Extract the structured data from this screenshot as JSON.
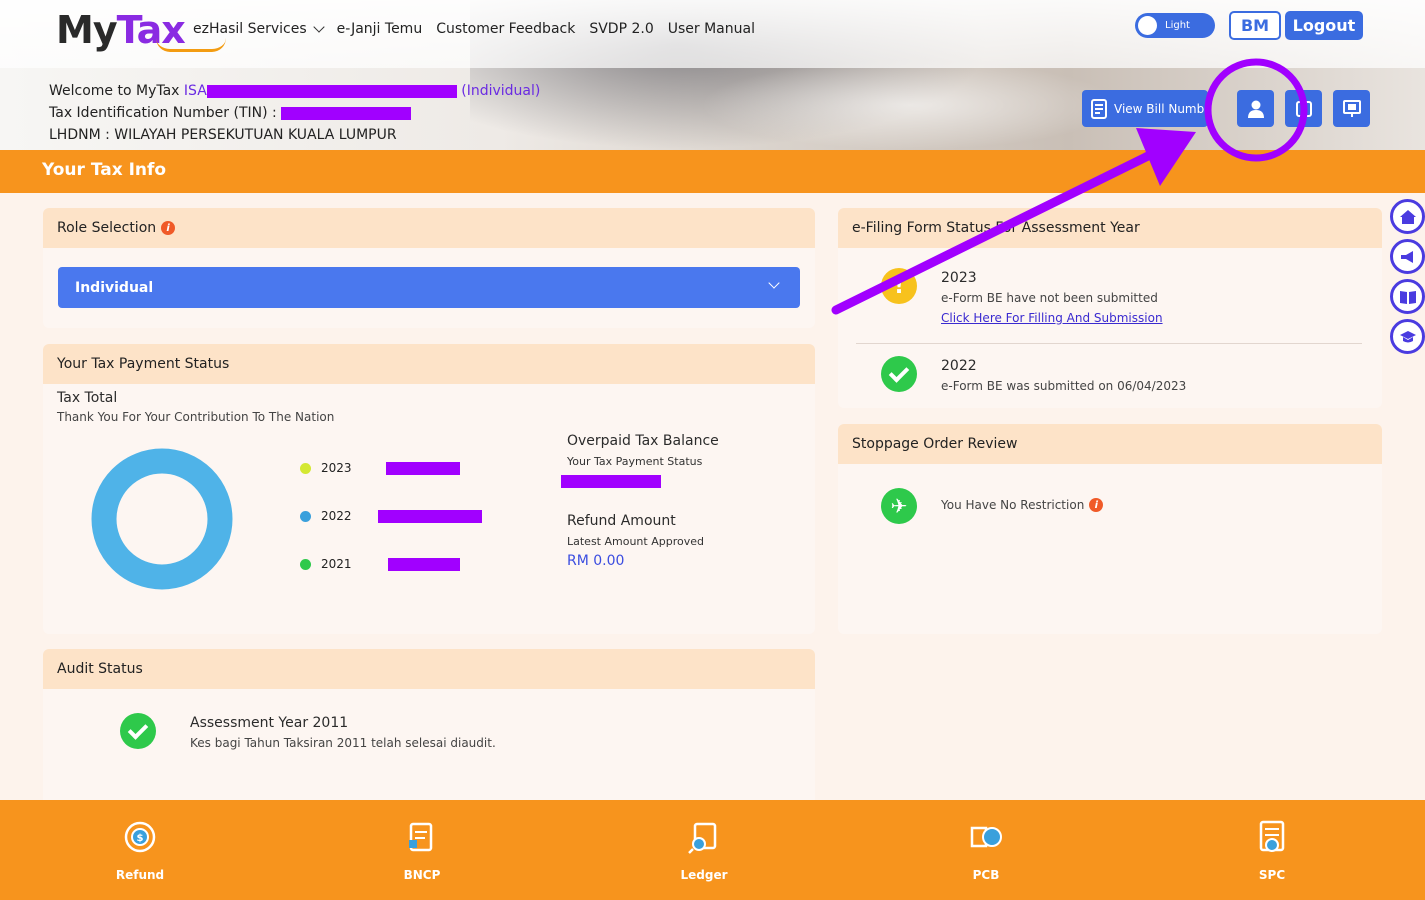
{
  "header": {
    "logo_my": "My",
    "logo_tax": "Tax",
    "nav": [
      {
        "label": "ezHasil Services",
        "dropdown": true
      },
      {
        "label": "e-Janji Temu"
      },
      {
        "label": "Customer Feedback"
      },
      {
        "label": "SVDP 2.0"
      },
      {
        "label": "User Manual"
      }
    ],
    "theme_toggle_label": "Light",
    "lang_button": "BM",
    "logout_button": "Logout",
    "view_bill_button": "View Bill Numb"
  },
  "welcome": {
    "line1_prefix": "Welcome to MyTax ",
    "name_visible": "ISA",
    "user_type": "(Individual)",
    "tin_label": "Tax Identification Number (TIN) :",
    "branch": "LHDNM : WILAYAH PERSEKUTUAN KUALA LUMPUR"
  },
  "page_title": "Your Tax Info",
  "role_selection": {
    "title": "Role Selection",
    "selected": "Individual"
  },
  "tax_payment": {
    "title": "Your Tax Payment Status",
    "total_label": "Tax Total",
    "subtitle": "Thank You For Your Contribution To The Nation",
    "legend": [
      {
        "year": "2023",
        "color": "#d4e832"
      },
      {
        "year": "2022",
        "color": "#3aa0dc"
      },
      {
        "year": "2021",
        "color": "#2ec94b"
      }
    ],
    "overpaid_title": "Overpaid Tax Balance",
    "overpaid_sub": "Your Tax Payment Status",
    "refund_title": "Refund Amount",
    "refund_sub": "Latest Amount Approved",
    "refund_value": "RM 0.00"
  },
  "audit": {
    "title": "Audit Status",
    "item_title": "Assessment Year 2011",
    "item_desc": "Kes bagi Tahun Taksiran 2011 telah selesai diaudit."
  },
  "efiling": {
    "title": "e-Filing Form Status For Assessment Year",
    "items": [
      {
        "year": "2023",
        "desc": "e-Form BE have not been submitted",
        "link": "Click Here For Filling And Submission"
      },
      {
        "year": "2022",
        "desc": "e-Form BE was submitted on 06/04/2023"
      }
    ]
  },
  "stoppage": {
    "title": "Stoppage Order Review",
    "text": "You Have No Restriction"
  },
  "bottom_nav": [
    {
      "label": "Refund"
    },
    {
      "label": "BNCP"
    },
    {
      "label": "Ledger"
    },
    {
      "label": "PCB"
    },
    {
      "label": "SPC"
    }
  ],
  "colors": {
    "accent_blue": "#3b6ce0",
    "orange": "#f7941d",
    "annotation_purple": "#a100ff"
  }
}
